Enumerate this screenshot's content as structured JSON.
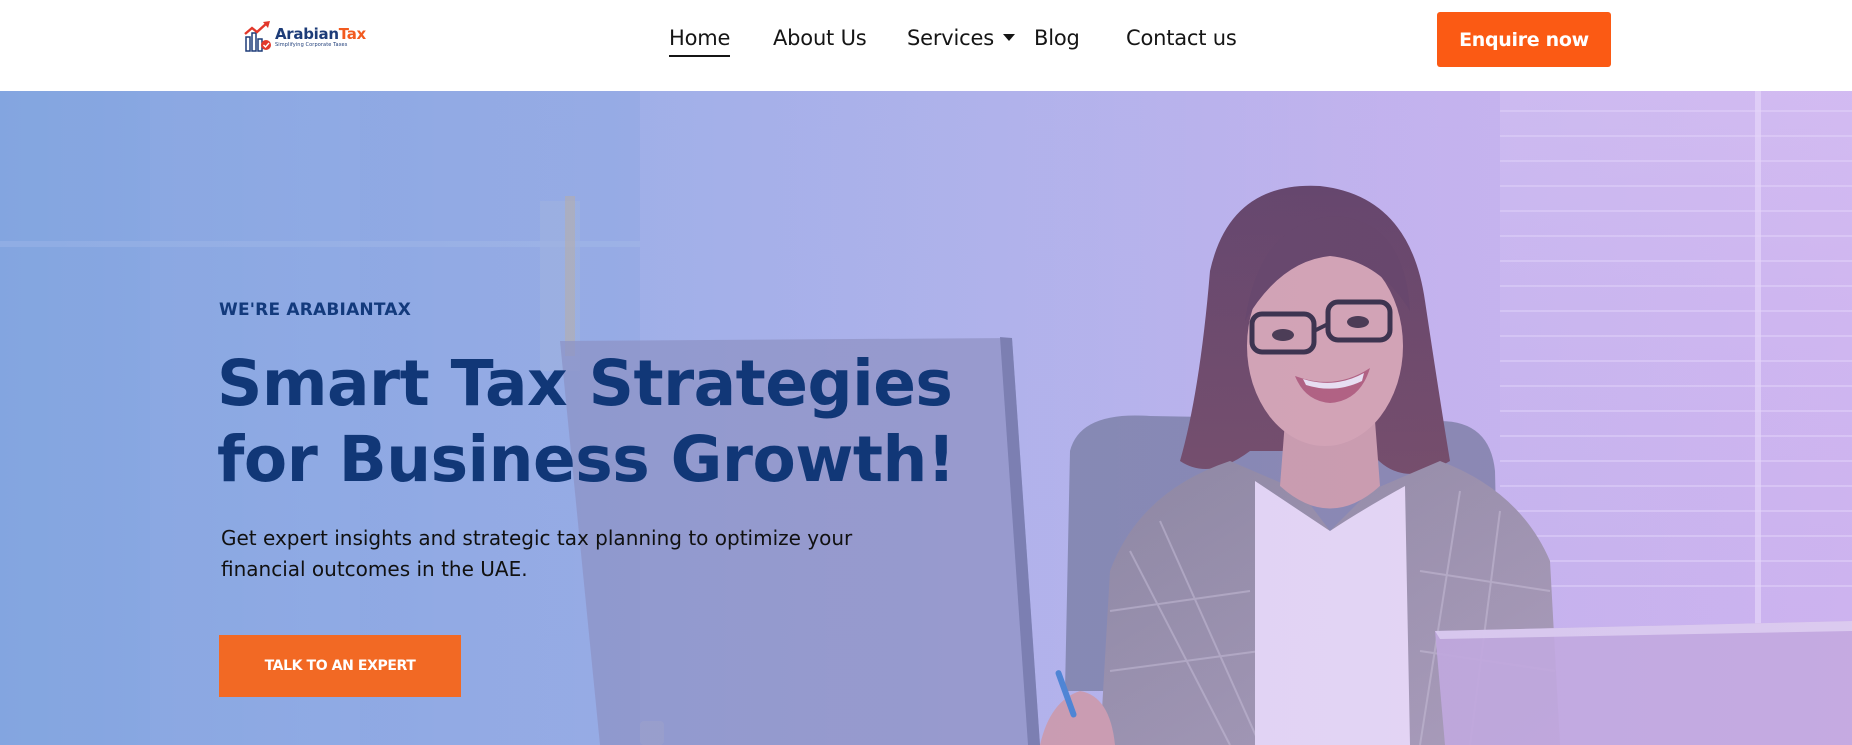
{
  "brand": {
    "name_part1": "Arabian",
    "name_part2": "Tax",
    "tagline": "Simplifying Corporate Taxes",
    "colors": {
      "navy": "#1d3c78",
      "orange": "#f25a1f"
    }
  },
  "nav": {
    "items": [
      {
        "label": "Home",
        "active": true
      },
      {
        "label": "About Us"
      },
      {
        "label": "Services",
        "has_dropdown": true
      },
      {
        "label": "Blog"
      },
      {
        "label": "Contact us"
      }
    ],
    "cta_label": "Enquire now",
    "cta_color": "#fb5a14"
  },
  "hero": {
    "eyebrow": "WE'RE ARABIANTAX",
    "headline_line1": "Smart Tax Strategies",
    "headline_line2": "for Business Growth!",
    "subcopy": "Get expert insights and strategic tax planning to optimize your financial outcomes in the UAE.",
    "cta_label": "TALK TO AN EXPERT",
    "colors": {
      "headline": "#113777",
      "cta": "#f26924"
    }
  },
  "icons": [
    "logo-chart-icon",
    "chevron-down-icon"
  ]
}
